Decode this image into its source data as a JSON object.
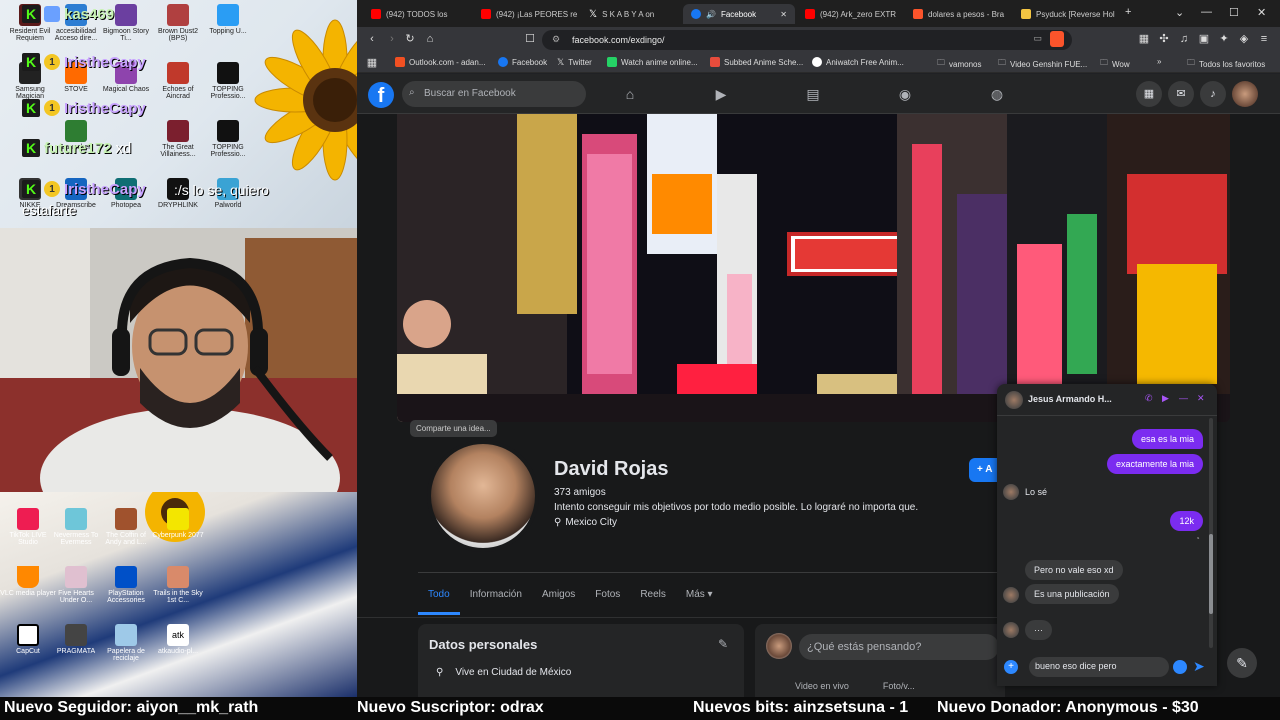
{
  "stream_chat": {
    "messages": [
      {
        "user": "kas469",
        "text": "",
        "color": "#c7f2b3"
      },
      {
        "user": "IristheCapy",
        "text": "",
        "color": "#c8a2ff"
      },
      {
        "user": "IristheCapy",
        "text": "",
        "color": "#c8a2ff"
      },
      {
        "user": "future172",
        "text": "xd",
        "color": "#c7f2b3"
      },
      {
        "user": "IristheCapy",
        "text": ":/s lo se, quiero estafarte",
        "color": "#c8a2ff"
      }
    ]
  },
  "desktop_top_icons": [
    "Resident Evil Requiem",
    "accesibilidad Acceso dire...",
    "Bigmoon Story Ti...",
    "Brown Dust2 (BPS)",
    "Topping U...",
    "Samsung Magician",
    "STOVE",
    "Magical Chaos",
    "Echoes of Aincrad",
    "TOPPING Professio...",
    "Launcher",
    "The Great Villainess...",
    "TOPPING Professio...",
    "NIKKE",
    "Dreamscribe",
    "Photopea",
    "DRYPHLINK",
    "Palworld"
  ],
  "desktop_bottom_icons": [
    "TikTok LIVE Studio",
    "Nevermess To Evermess",
    "The Coffin of Andy and L...",
    "Cyberpunk 2077",
    "VLC media player",
    "Five Hearts Under O...",
    "PlayStation Accessories",
    "Trails in the Sky 1st C...",
    "CapCut",
    "PRAGMATA",
    "Papelera de reciclaje",
    "atkaudio-pl..."
  ],
  "browser": {
    "tabs": [
      {
        "label": "(942) TODOS los",
        "fav": "#ff0000"
      },
      {
        "label": "(942) ¡Las PEORES re",
        "fav": "#ff0000"
      },
      {
        "label": "S K A B Y A  on",
        "fav": "#ffffff"
      },
      {
        "label": "Facebook",
        "fav": "#1877f2"
      },
      {
        "label": "(942) Ark_zero EXTR",
        "fav": "#ff0000"
      },
      {
        "label": "dolares a pesos - Bra",
        "fav": "#fb542b"
      },
      {
        "label": "Psyduck [Reverse Hol",
        "fav": "#f4c542"
      }
    ],
    "url": "facebook.com/exdingo/",
    "bookmarks": [
      {
        "label": "Outlook.com - adan...",
        "color": "#f25022"
      },
      {
        "label": "Facebook",
        "color": "#1877f2"
      },
      {
        "label": "Twitter",
        "color": "#ffffff"
      },
      {
        "label": "Watch anime online...",
        "color": "#25d366"
      },
      {
        "label": "Subbed Anime Sche...",
        "color": "#e74c3c"
      },
      {
        "label": "Aniwatch Free Anim...",
        "color": "#ffffff"
      },
      {
        "label": "vamonos",
        "color": "#999999"
      },
      {
        "label": "Video Genshin FUE...",
        "color": "#999999"
      },
      {
        "label": "Wow",
        "color": "#999999"
      }
    ],
    "bookmarks_more": "Todos los favoritos"
  },
  "facebook": {
    "search_placeholder": "Buscar en Facebook",
    "cover_hint": "Comparte una idea...",
    "name": "David Rojas",
    "friends": "373 amigos",
    "bio": "Intento conseguir mis objetivos por todo medio posible. Lo lograré no importa que.",
    "location": "Mexico City",
    "add_label": "+ A",
    "tabs": [
      "Todo",
      "Información",
      "Amigos",
      "Fotos",
      "Reels",
      "Más ▾"
    ],
    "datos_title": "Datos personales",
    "datos_row": "Vive en Ciudad de México",
    "post_placeholder": "¿Qué estás pensando?",
    "post_actions": [
      "Video en vivo",
      "Foto/v..."
    ]
  },
  "messenger": {
    "contact": "Jesus Armando H...",
    "messages": [
      {
        "from": "me",
        "text": "esa es la mia"
      },
      {
        "from": "me",
        "text": "exactamente la mia"
      },
      {
        "from": "them",
        "text": "Lo sé"
      },
      {
        "from": "me",
        "text": "12k"
      },
      {
        "from": "them",
        "text": "Pero no vale eso xd"
      },
      {
        "from": "them",
        "text": "Es una publicación"
      },
      {
        "from": "them",
        "text": "···"
      }
    ],
    "draft": "bueno eso dice pero"
  },
  "ticker": [
    "Nuevo Seguidor: aiyon__mk_rath",
    "Nuevo Suscriptor: odrax",
    "Nuevos bits: ainzsetsuna - 1",
    "Nuevo Donador: Anonymous - $30"
  ]
}
